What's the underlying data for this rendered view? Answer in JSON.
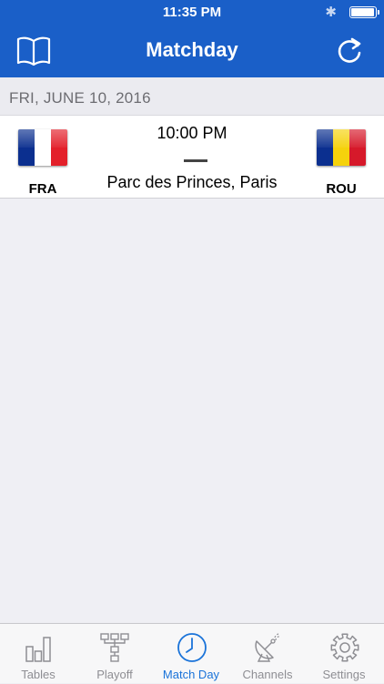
{
  "status_bar": {
    "time": "11:35 PM",
    "bluetooth_icon": "bluetooth-icon",
    "battery_icon": "battery-icon",
    "battery_level": 0.95
  },
  "nav": {
    "title": "Matchday",
    "left_icon": "book-icon",
    "right_icon": "refresh-icon"
  },
  "section": {
    "date": "FRI, JUNE 10, 2016"
  },
  "match": {
    "home_code": "FRA",
    "away_code": "ROU",
    "kickoff": "10:00 PM",
    "score_separator": "—",
    "venue": "Parc des Princes, Paris",
    "home_flag_colors": [
      "#0b2f8f",
      "#ffffff",
      "#e3202a"
    ],
    "away_flag_colors": [
      "#0b2f8f",
      "#f5d20c",
      "#d6192a"
    ]
  },
  "tabs": [
    {
      "label": "Tables",
      "icon": "bar-chart-icon"
    },
    {
      "label": "Playoff",
      "icon": "bracket-icon"
    },
    {
      "label": "Match Day",
      "icon": "clock-icon",
      "active": true
    },
    {
      "label": "Channels",
      "icon": "satellite-dish-icon"
    },
    {
      "label": "Settings",
      "icon": "gear-icon"
    }
  ],
  "colors": {
    "brand": "#1a5fc8",
    "active_tab": "#1a73d9",
    "inactive_tab": "#8e8e93",
    "background": "#efeff4"
  }
}
